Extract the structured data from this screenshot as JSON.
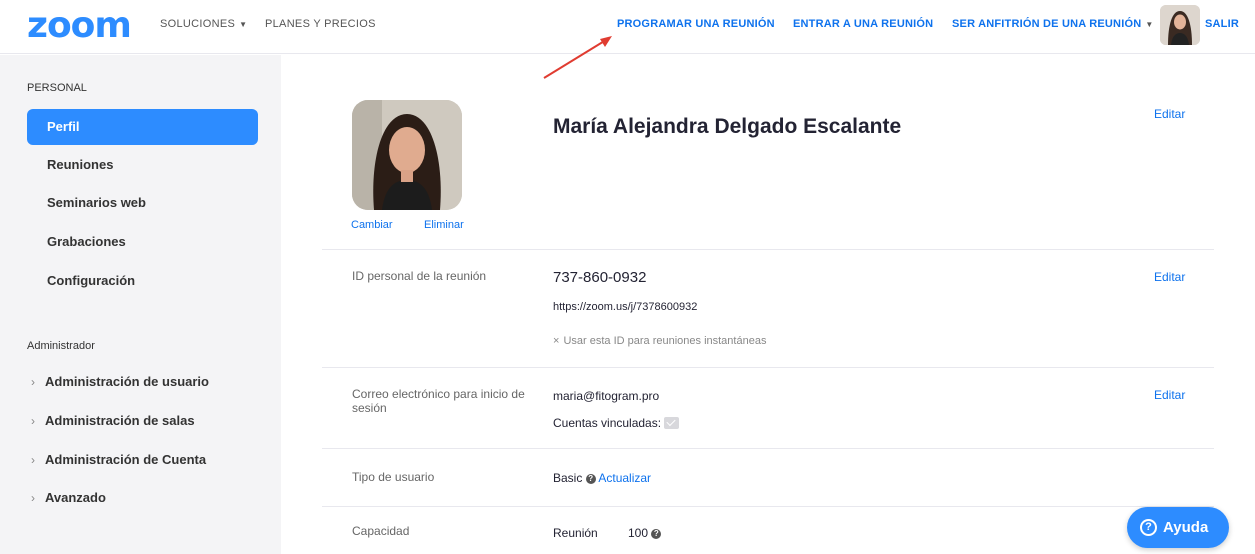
{
  "nav": {
    "logo": "zoom",
    "solutions": "SOLUCIONES",
    "plans": "PLANES Y PRECIOS",
    "schedule": "PROGRAMAR UNA REUNIÓN",
    "join": "ENTRAR A UNA REUNIÓN",
    "host": "SER ANFITRIÓN DE UNA REUNIÓN",
    "exit": "SALIR"
  },
  "sidebar": {
    "personal_header": "PERSONAL",
    "items": [
      {
        "label": "Perfil"
      },
      {
        "label": "Reuniones"
      },
      {
        "label": "Seminarios web"
      },
      {
        "label": "Grabaciones"
      },
      {
        "label": "Configuración"
      }
    ],
    "admin_header": "Administrador",
    "admin_items": [
      {
        "label": "Administración de usuario"
      },
      {
        "label": "Administración de salas"
      },
      {
        "label": "Administración de Cuenta"
      },
      {
        "label": "Avanzado"
      }
    ]
  },
  "profile": {
    "name": "María Alejandra Delgado Escalante",
    "change": "Cambiar",
    "delete": "Eliminar",
    "edit": "Editar"
  },
  "meeting_id": {
    "label": "ID personal de la reunión",
    "value": "737-860-0932",
    "url": "https://zoom.us/j/7378600932",
    "option": "Usar esta ID para reuniones instantáneas",
    "edit": "Editar"
  },
  "email": {
    "label": "Correo electrónico para inicio de sesión",
    "value": "maria@fitogram.pro",
    "linked": "Cuentas vinculadas:",
    "edit": "Editar"
  },
  "user_type": {
    "label": "Tipo de usuario",
    "value": "Basic",
    "upgrade": "Actualizar"
  },
  "capacity": {
    "label": "Capacidad",
    "meeting_label": "Reunión",
    "meeting_value": "100"
  },
  "help": {
    "label": "Ayuda"
  },
  "colors": {
    "accent": "#2d8cff",
    "link": "#0e72ed",
    "annotation": "#e03c31"
  }
}
